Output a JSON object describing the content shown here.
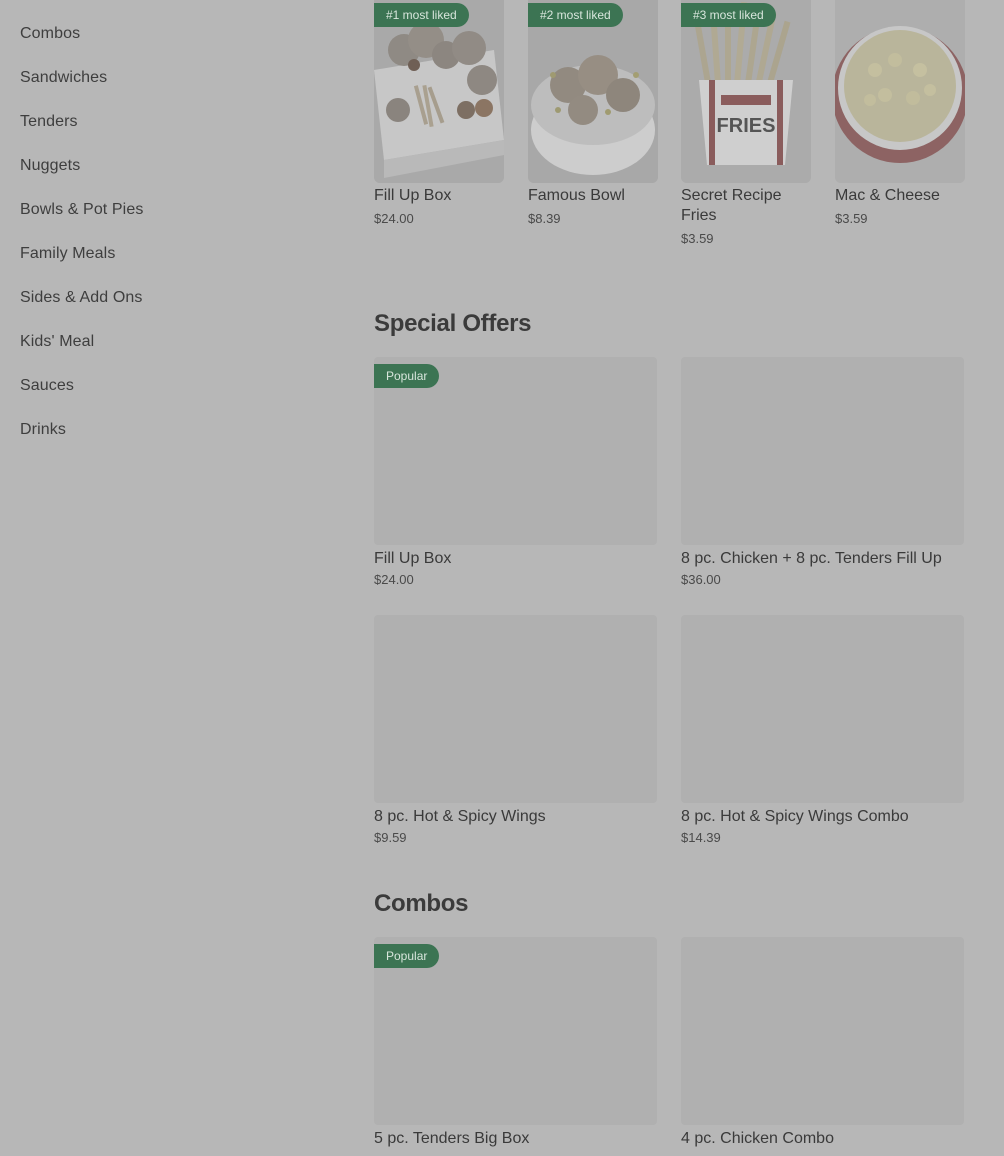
{
  "sidebar": {
    "items": [
      {
        "label": "Combos"
      },
      {
        "label": "Sandwiches"
      },
      {
        "label": "Tenders"
      },
      {
        "label": "Nuggets"
      },
      {
        "label": "Bowls & Pot Pies"
      },
      {
        "label": "Family Meals"
      },
      {
        "label": "Sides & Add Ons"
      },
      {
        "label": "Kids' Meal"
      },
      {
        "label": "Sauces"
      },
      {
        "label": "Drinks"
      }
    ]
  },
  "most_liked": {
    "items": [
      {
        "badge": "#1 most liked",
        "name": "Fill Up Box",
        "price": "$24.00",
        "image": "fill-up-box-photo"
      },
      {
        "badge": "#2 most liked",
        "name": "Famous Bowl",
        "price": "$8.39",
        "image": "famous-bowl-photo"
      },
      {
        "badge": "#3 most liked",
        "name": "Secret Recipe Fries",
        "price": "$3.59",
        "image": "fries-photo",
        "packaging_text": "FRIES"
      },
      {
        "badge": "",
        "name": "Mac & Cheese",
        "price": "$3.59",
        "image": "mac-and-cheese-photo"
      }
    ]
  },
  "special_offers": {
    "title": "Special Offers",
    "items": [
      {
        "badge": "Popular",
        "name": "Fill Up Box",
        "price": "$24.00"
      },
      {
        "badge": "",
        "name": "8 pc. Chicken + 8 pc. Tenders Fill Up",
        "price": "$36.00"
      },
      {
        "badge": "",
        "name": "8 pc. Hot & Spicy Wings",
        "price": "$9.59"
      },
      {
        "badge": "",
        "name": "8 pc. Hot & Spicy Wings Combo",
        "price": "$14.39"
      }
    ]
  },
  "combos": {
    "title": "Combos",
    "items": [
      {
        "badge": "Popular",
        "name": "5 pc. Tenders Big Box"
      },
      {
        "badge": "",
        "name": "4 pc. Chicken Combo"
      }
    ]
  },
  "colors": {
    "background": "#b7b7b7",
    "badge_bg": "#3c7453",
    "badge_text": "#d8e6dc",
    "placeholder": "#b0b0b0"
  }
}
